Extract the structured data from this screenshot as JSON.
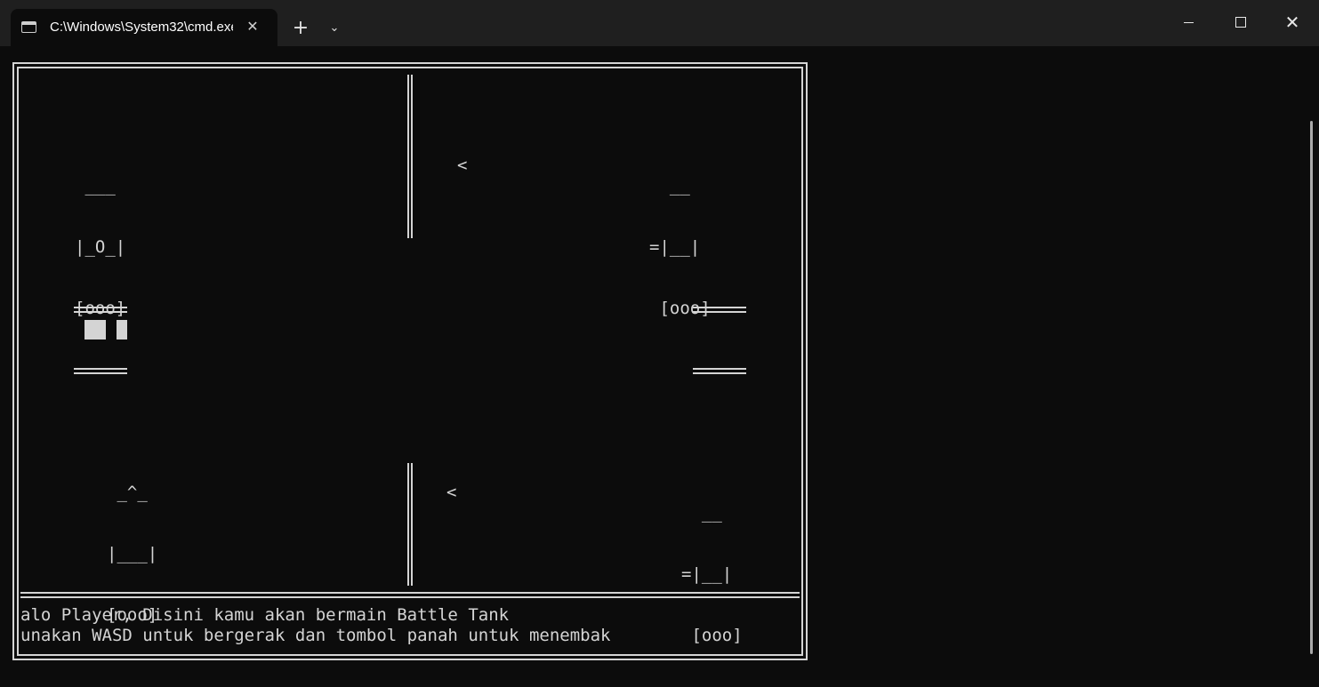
{
  "window": {
    "tab_title": "C:\\Windows\\System32\\cmd.exe",
    "tab_close": "✕",
    "new_tab": "+",
    "tab_dropdown": "⌄",
    "close_label": "✕",
    "icons": {
      "tab": "terminal-icon",
      "minimize": "minimize-icon",
      "maximize": "maximize-icon",
      "close": "close-icon"
    }
  },
  "game": {
    "player_tank": [
      " ___",
      "|_O_|",
      "[ooo]"
    ],
    "enemy_tank_top": [
      "  __",
      "=|__|",
      " [ooo]"
    ],
    "enemy_tank_bottom": [
      "  __",
      "=|__|",
      " [ooo]"
    ],
    "ally_tank": [
      " _^_",
      "|___|",
      "[ooo]"
    ],
    "bullet_top": "<",
    "bullet_bottom": "<",
    "messages": [
      "alo Player, Disini kamu akan bermain Battle Tank",
      "unakan WASD untuk bergerak dan tombol panah untuk menembak"
    ]
  }
}
